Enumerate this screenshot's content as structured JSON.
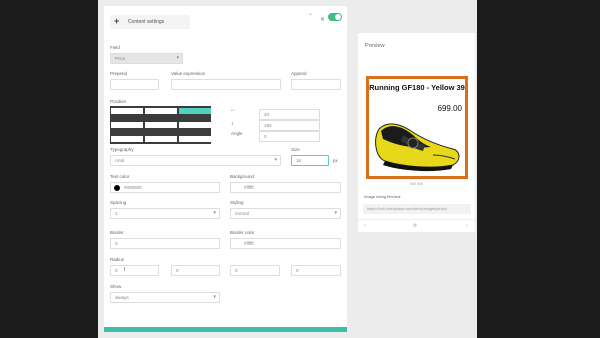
{
  "header": {
    "title": "Content settings"
  },
  "field": {
    "label": "Field",
    "value": "Price"
  },
  "prepend": {
    "label": "Prepend"
  },
  "value_expression": {
    "label": "Value expression"
  },
  "append": {
    "label": "Append"
  },
  "position": {
    "label": "Position",
    "x": "20",
    "y": "190",
    "angle_label": "Angle",
    "angle": "0"
  },
  "typography": {
    "label": "Typography",
    "font": "Arial",
    "size_label": "Size",
    "size": "16",
    "unit": "px"
  },
  "text_color": {
    "label": "Text color",
    "value": "#000000",
    "color": "#000000"
  },
  "background": {
    "label": "Background",
    "value": "#ffffff"
  },
  "spacing": {
    "label": "Spacing",
    "value": "1"
  },
  "styling": {
    "label": "Styling",
    "value": "normal"
  },
  "border": {
    "label": "Border",
    "value": "0"
  },
  "border_color": {
    "label": "Border color",
    "value": "#ffffff"
  },
  "radius": {
    "label": "Radius",
    "values": [
      "0",
      "0",
      "0",
      "0"
    ]
  },
  "show": {
    "label": "Show",
    "value": "always"
  },
  "preview": {
    "title": "Preview",
    "product_name": "Running GF180 - Yellow 39",
    "price": "699.00",
    "image_size": "640 640",
    "fetch_label": "Image being fetched:",
    "url": "https://hub.videoplaza.com/demo/images/produ",
    "nav_prev": "‹",
    "nav_refresh": "⟳",
    "nav_next": "›"
  },
  "colors": {
    "accent": "#3fbfa8",
    "toggle": "#3fbf7f",
    "frame": "#d9701a",
    "grid_active": "#52d0c0"
  }
}
